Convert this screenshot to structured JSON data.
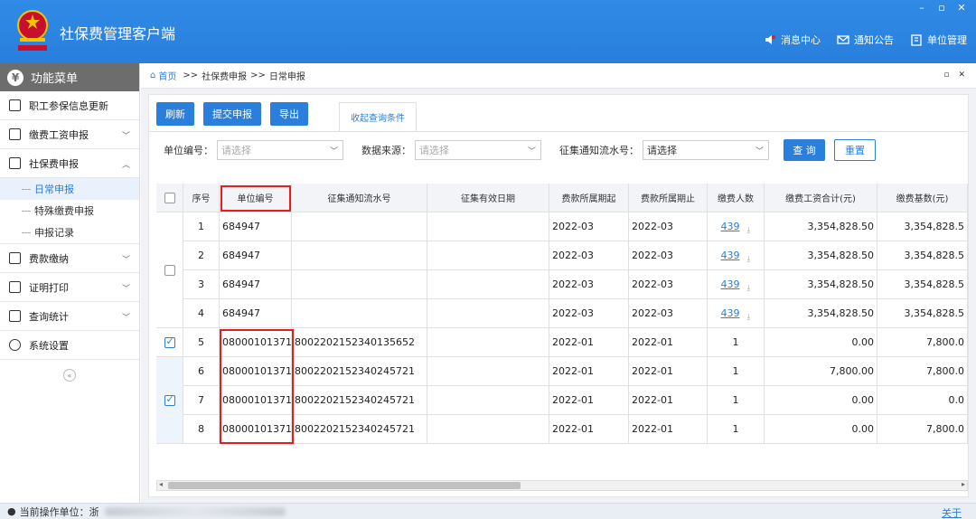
{
  "app": {
    "title": "社保费管理客户端"
  },
  "window_controls": [
    "–",
    "▫",
    "✕"
  ],
  "header_links": [
    {
      "label": "消息中心",
      "icon": "speaker-icon"
    },
    {
      "label": "通知公告",
      "icon": "mail-icon"
    },
    {
      "label": "单位管理",
      "icon": "building-icon"
    }
  ],
  "sidebar": {
    "header": "功能菜单",
    "items": [
      {
        "label": "职工参保信息更新"
      },
      {
        "label": "缴费工资申报"
      },
      {
        "label": "社保费申报"
      },
      {
        "label": "费款缴纳"
      },
      {
        "label": "证明打印"
      },
      {
        "label": "查询统计"
      },
      {
        "label": "系统设置"
      }
    ],
    "submenu": [
      {
        "label": "日常申报"
      },
      {
        "label": "特殊缴费申报"
      },
      {
        "label": "申报记录"
      }
    ],
    "collapse": "«"
  },
  "breadcrumb": {
    "home": "首页",
    "sep": ">>",
    "level1": "社保费申报",
    "level2": "日常申报"
  },
  "toolbar": {
    "refresh": "刷新",
    "submit": "提交申报",
    "export": "导出",
    "collapse_tab": "收起查询条件"
  },
  "filters": {
    "unit_label": "单位编号：",
    "unit_placeholder": "请选择",
    "source_label": "数据来源：",
    "source_placeholder": "请选择",
    "notice_label": "征集通知流水号：",
    "notice_value": "请选择",
    "query": "查 询",
    "reset": "重置"
  },
  "table": {
    "headers": [
      "序号",
      "单位编号",
      "征集通知流水号",
      "征集有效日期",
      "费款所属期起",
      "费款所属期止",
      "缴费人数",
      "缴费工资合计(元)",
      "缴费基数(元)"
    ],
    "rows": [
      {
        "seq": "1",
        "unit": "684947",
        "notice": "",
        "valid": "",
        "from": "2022-03",
        "to": "2022-03",
        "count": "439",
        "wage": "3,354,828.50",
        "base": "3,354,828.5"
      },
      {
        "seq": "2",
        "unit": "684947",
        "notice": "",
        "valid": "",
        "from": "2022-03",
        "to": "2022-03",
        "count": "439",
        "wage": "3,354,828.50",
        "base": "3,354,828.5"
      },
      {
        "seq": "3",
        "unit": "684947",
        "notice": "",
        "valid": "",
        "from": "2022-03",
        "to": "2022-03",
        "count": "439",
        "wage": "3,354,828.50",
        "base": "3,354,828.5"
      },
      {
        "seq": "4",
        "unit": "684947",
        "notice": "",
        "valid": "",
        "from": "2022-03",
        "to": "2022-03",
        "count": "439",
        "wage": "3,354,828.50",
        "base": "3,354,828.5"
      },
      {
        "seq": "5",
        "unit": "08000101371",
        "notice": "8002202152340135652",
        "valid": "",
        "from": "2022-01",
        "to": "2022-01",
        "count": "1",
        "wage": "0.00",
        "base": "7,800.0"
      },
      {
        "seq": "6",
        "unit": "08000101371",
        "notice": "8002202152340245721",
        "valid": "",
        "from": "2022-01",
        "to": "2022-01",
        "count": "1",
        "wage": "7,800.00",
        "base": "7,800.0"
      },
      {
        "seq": "7",
        "unit": "08000101371",
        "notice": "8002202152340245721",
        "valid": "",
        "from": "2022-01",
        "to": "2022-01",
        "count": "1",
        "wage": "0.00",
        "base": "0.0"
      },
      {
        "seq": "8",
        "unit": "08000101371",
        "notice": "8002202152340245721",
        "valid": "",
        "from": "2022-01",
        "to": "2022-01",
        "count": "1",
        "wage": "0.00",
        "base": "7,800.0"
      }
    ]
  },
  "status": {
    "label": "当前操作单位：",
    "value": "浙",
    "about": "关于"
  },
  "colors": {
    "header_blue": "#2a7fdc",
    "highlight_red": "#e02020"
  }
}
